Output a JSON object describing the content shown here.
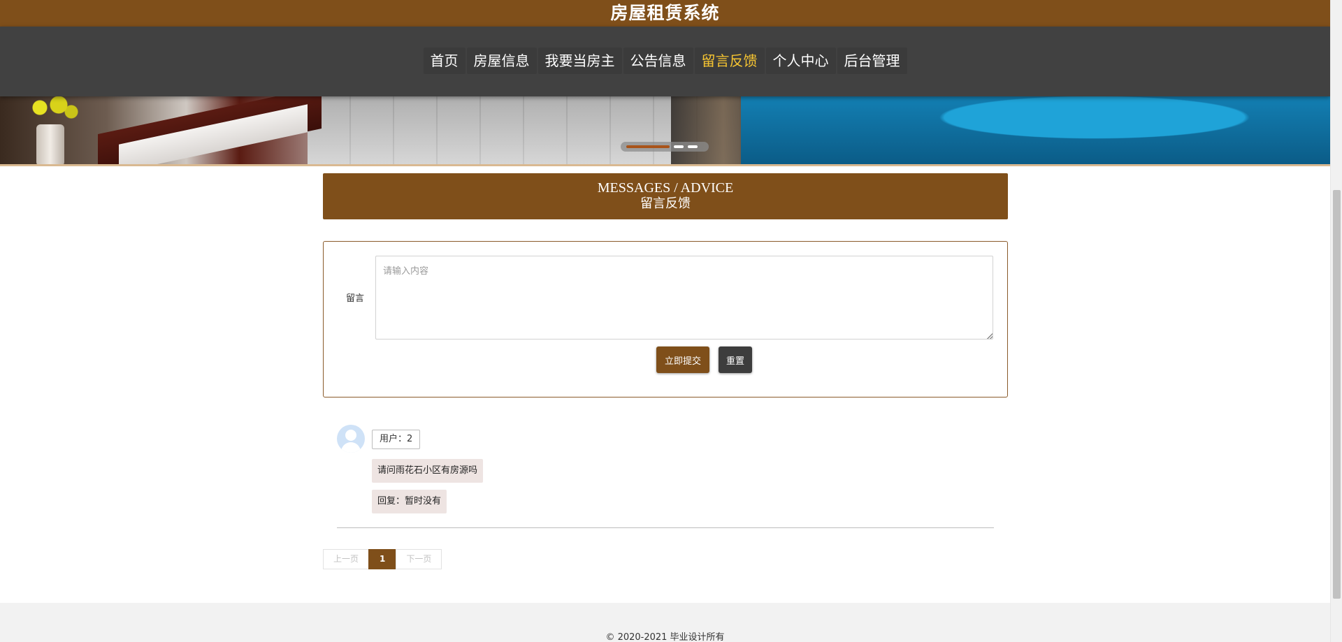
{
  "header": {
    "site_title": "房屋租赁系统"
  },
  "nav": {
    "items": [
      {
        "label": "首页",
        "active": false
      },
      {
        "label": "房屋信息",
        "active": false
      },
      {
        "label": "我要当房主",
        "active": false
      },
      {
        "label": "公告信息",
        "active": false
      },
      {
        "label": "留言反馈",
        "active": true
      },
      {
        "label": "个人中心",
        "active": false
      },
      {
        "label": "后台管理",
        "active": false
      }
    ],
    "active_color": "#f7c531"
  },
  "banner": {
    "slide_count": 3,
    "active_slide": 1
  },
  "section": {
    "title_en": "MESSAGES / ADVICE",
    "title_zh": "留言反馈"
  },
  "form": {
    "label": "留言",
    "textarea_placeholder": "请输入内容",
    "textarea_value": "",
    "submit_label": "立即提交",
    "reset_label": "重置"
  },
  "comments": [
    {
      "user": "用户：2",
      "content": "请问雨花石小区有房源吗",
      "reply": "回复：暂时没有",
      "avatar_icon": "user-avatar-icon"
    }
  ],
  "pagination": {
    "prev_label": "上一页",
    "current_page": "1",
    "next_label": "下一页"
  },
  "footer": {
    "copyright": "© 2020-2021 毕业设计所有"
  },
  "colors": {
    "brand": "#7f4f1a",
    "nav_bg": "#414141",
    "reset_btn": "#3d3d3d",
    "bubble_bg": "#eee4e2"
  }
}
